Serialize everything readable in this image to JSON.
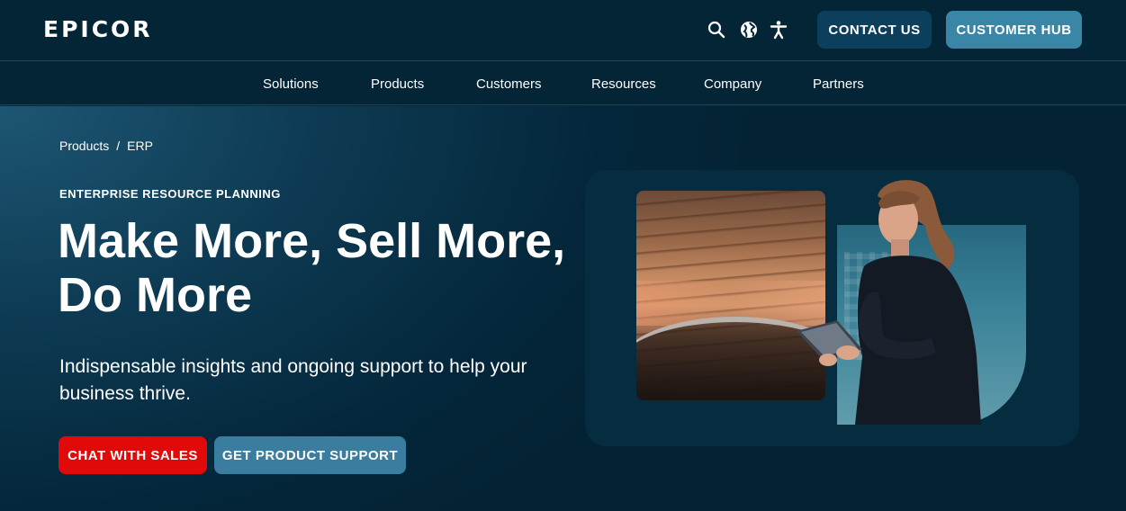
{
  "header": {
    "logo_text": "EPICOR",
    "icons": [
      "search-icon",
      "globe-icon",
      "accessibility-icon"
    ],
    "contact_label": "CONTACT US",
    "hub_label": "CUSTOMER HUB"
  },
  "nav": {
    "items": [
      "Solutions",
      "Products",
      "Customers",
      "Resources",
      "Company",
      "Partners"
    ]
  },
  "breadcrumb": {
    "items": [
      "Products",
      "ERP"
    ],
    "separator": "/"
  },
  "hero": {
    "eyebrow": "ENTERPRISE RESOURCE PLANNING",
    "headline": "Make More, Sell More, Do More",
    "subtext": "Indispensable insights and ongoing support to help your business thrive.",
    "primary_cta": "CHAT WITH SALES",
    "secondary_cta": "GET PRODUCT SUPPORT"
  },
  "colors": {
    "header_bg": "#032536",
    "hero_bg": "#05283a",
    "contact_btn": "#0c3f5c",
    "hub_btn": "#3a86a6",
    "chat_btn": "#e00a0a",
    "support_btn": "#3a7d9e"
  }
}
